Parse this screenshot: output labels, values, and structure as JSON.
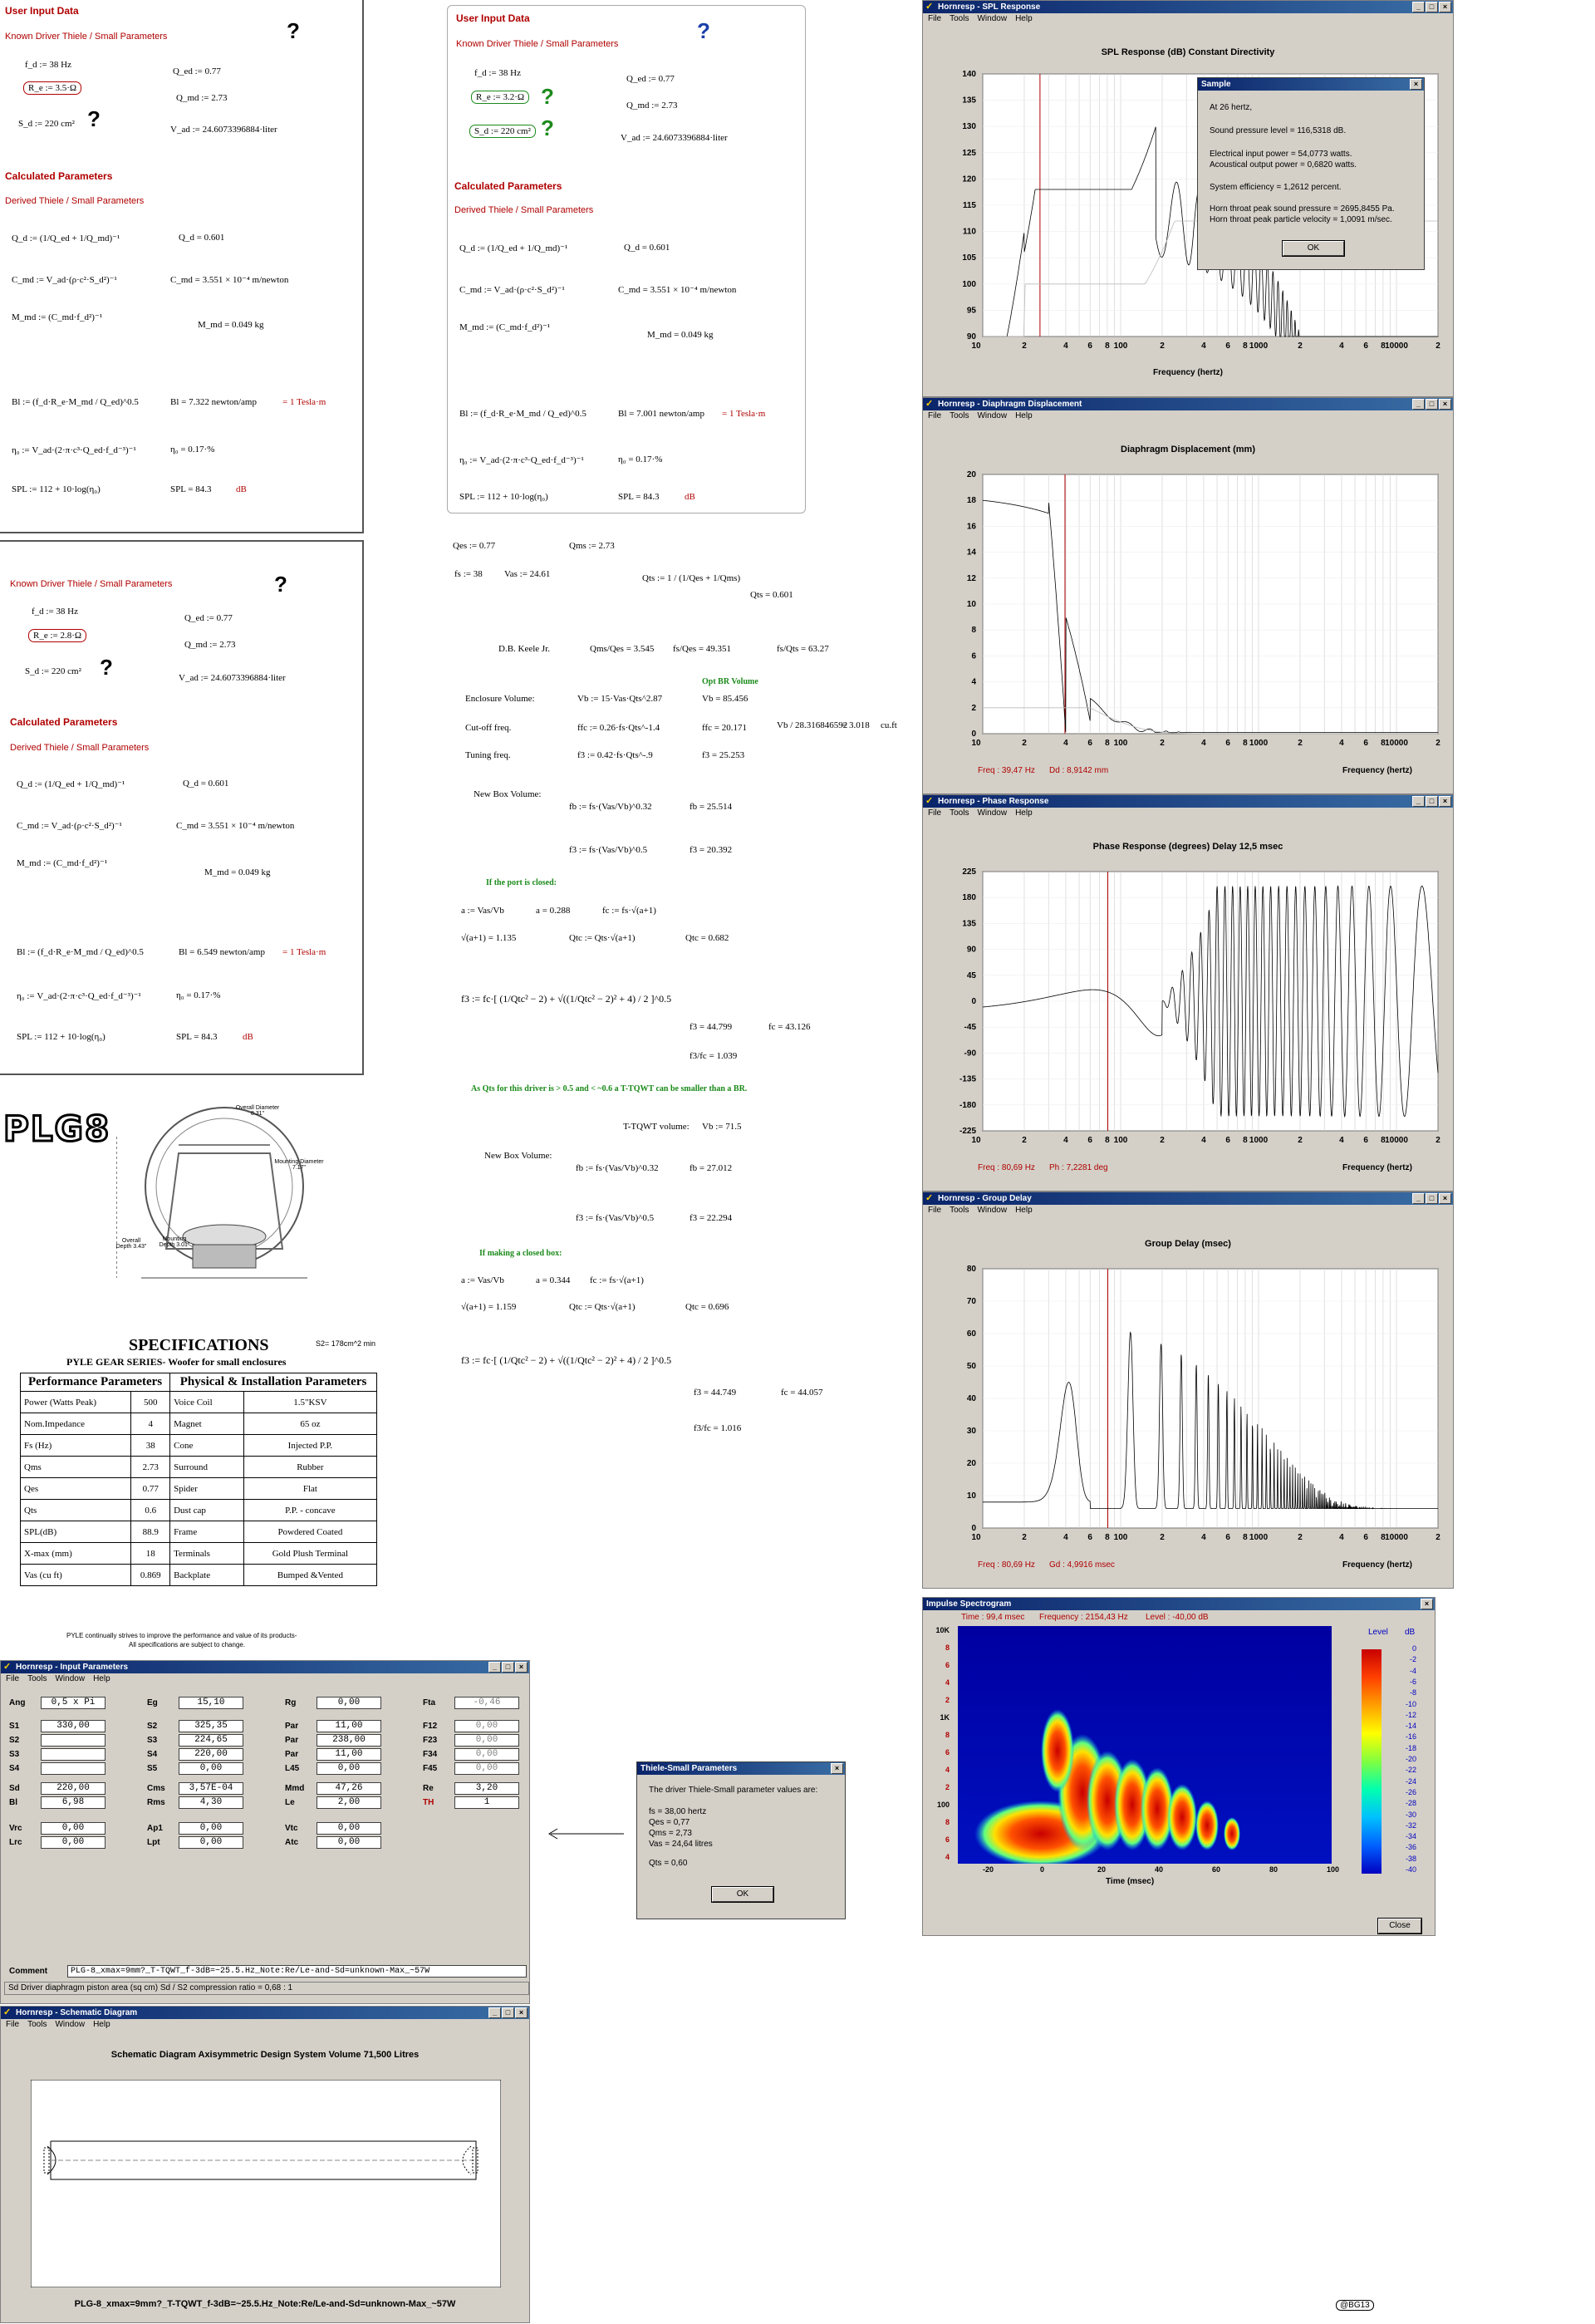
{
  "sheet1": {
    "user_input": "User Input Data",
    "known": "Known Driver Thiele / Small Parameters",
    "fd": "f_d := 38 Hz",
    "re": "R_e := 3.5·Ω",
    "sd": "S_d := 220 cm²",
    "qed": "Q_ed := 0.77",
    "qmd": "Q_md := 2.73",
    "vad": "V_ad := 24.6073396884·liter",
    "calc": "Calculated Parameters",
    "derived": "Derived Thiele / Small Parameters",
    "qd_def": "Q_d := (1/Q_ed + 1/Q_md)⁻¹",
    "qd_val": "Q_d = 0.601",
    "cmd_def": "C_md := V_ad·(ρ·c²·S_d²)⁻¹",
    "cmd_val": "C_md = 3.551 × 10⁻⁴ m/newton",
    "mmd_def": "M_md := (C_md·f_d²)⁻¹",
    "mmd_val": "M_md = 0.049 kg",
    "bl_def": "Bl := (f_d·R_e·M_md / Q_ed)^0.5",
    "bl_val": "Bl = 7.322 newton/amp",
    "bl_t": "= 1 Tesla·m",
    "eta_def": "η₀ := V_ad·(2·π·c³·Q_ed·f_d⁻³)⁻¹",
    "eta_val": "η₀ = 0.17·%",
    "spl_def": "SPL := 112 + 10·log(η₀)",
    "spl_val": "SPL = 84.3",
    "db": "dB",
    "q": "?"
  },
  "sheet2": {
    "user_input": "User Input Data",
    "known": "Known Driver Thiele / Small Parameters",
    "fd": "f_d := 38 Hz",
    "re": "R_e := 3.2·Ω",
    "sd": "S_d := 220 cm²",
    "qed": "Q_ed := 0.77",
    "qmd": "Q_md := 2.73",
    "vad": "V_ad := 24.6073396884·liter",
    "calc": "Calculated Parameters",
    "derived": "Derived Thiele / Small Parameters",
    "qd_def": "Q_d := (1/Q_ed + 1/Q_md)⁻¹",
    "qd_val": "Q_d = 0.601",
    "cmd_def": "C_md := V_ad·(ρ·c²·S_d²)⁻¹",
    "cmd_val": "C_md = 3.551 × 10⁻⁴ m/newton",
    "mmd_def": "M_md := (C_md·f_d²)⁻¹",
    "mmd_val": "M_md = 0.049 kg",
    "bl_def": "Bl := (f_d·R_e·M_md / Q_ed)^0.5",
    "bl_val": "Bl = 7.001 newton/amp",
    "bl_t": "= 1 Tesla·m",
    "eta_def": "η₀ := V_ad·(2·π·c³·Q_ed·f_d⁻³)⁻¹",
    "eta_val": "η₀ = 0.17·%",
    "spl_def": "SPL := 112 + 10·log(η₀)",
    "spl_val": "SPL = 84.3",
    "db": "dB",
    "q": "?",
    "check": "?"
  },
  "sheet3": {
    "known": "Known Driver Thiele / Small Parameters",
    "fd": "f_d := 38 Hz",
    "re": "R_e := 2.8·Ω",
    "sd": "S_d := 220 cm²",
    "qed": "Q_ed := 0.77",
    "qmd": "Q_md := 2.73",
    "vad": "V_ad := 24.6073396884·liter",
    "calc": "Calculated Parameters",
    "derived": "Derived Thiele / Small Parameters",
    "qd_def": "Q_d := (1/Q_ed + 1/Q_md)⁻¹",
    "qd_val": "Q_d = 0.601",
    "cmd_def": "C_md := V_ad·(ρ·c²·S_d²)⁻¹",
    "cmd_val": "C_md = 3.551 × 10⁻⁴ m/newton",
    "mmd_def": "M_md := (C_md·f_d²)⁻¹",
    "mmd_val": "M_md = 0.049 kg",
    "bl_def": "Bl := (f_d·R_e·M_md / Q_ed)^0.5",
    "bl_val": "Bl = 6.549 newton/amp",
    "bl_t": "= 1 Tesla·m",
    "eta_def": "η₀ := V_ad·(2·π·c³·Q_ed·f_d⁻³)⁻¹",
    "eta_val": "η₀ = 0.17·%",
    "spl_def": "SPL := 112 + 10·log(η₀)",
    "spl_val": "SPL = 84.3",
    "db": "dB",
    "q": "?"
  },
  "calc": {
    "qes": "Qes := 0.77",
    "qms": "Qms := 2.73",
    "fs": "fs := 38",
    "vas": "Vas := 24.61",
    "qts_def": "Qts := 1 / (1/Qes + 1/Qms)",
    "qts_val": "Qts = 0.601",
    "keele": "D.B. Keele Jr.",
    "k1": "Qms/Qes = 3.545",
    "k2": "fs/Qes = 49.351",
    "k3": "fs/Qts = 63.27",
    "optbr": "Opt BR Volume",
    "encl_lbl": "Enclosure Volume:",
    "encl_def": "Vb := 15·Vas·Qts^2.87",
    "encl_val": "Vb = 85.456",
    "cut_lbl": "Cut-off freq.",
    "cut_def": "ffc := 0.26·fs·Qts^-1.4",
    "cut_val": "ffc = 20.171",
    "cuft_def": "Vb / 28.316846592",
    "cuft_val": "= 3.018",
    "cuft_unit": "cu.ft",
    "tune_lbl": "Tuning freq.",
    "tune_def": "f3 := 0.42·fs·Qts^-.9",
    "tune_val": "f3 = 25.253",
    "nbv": "New Box Volume:",
    "fb1_def": "fb := fs·(Vas/Vb)^0.32",
    "fb1_val": "fb = 25.514",
    "f31_def": "f3 := fs·(Vas/Vb)^0.5",
    "f31_val": "f3 = 20.392",
    "closed1": "If the port is closed:",
    "a1_def": "a := Vas/Vb",
    "a1_val": "a = 0.288",
    "fc1_def": "fc := fs·√(a+1)",
    "sq1": "√(a+1) = 1.135",
    "qtc1_def": "Qtc := Qts·√(a+1)",
    "qtc1_val": "Qtc = 0.682",
    "f3big1": "f3 := fc·[ (1/Qtc² − 2) + √((1/Qtc² − 2)² + 4) / 2 ]^0.5",
    "f3big1_val": "f3 = 44.799",
    "fc1_val": "fc = 43.126",
    "ratio1": "f3/fc = 1.039",
    "note": "As Qts for this driver is > 0.5  and < ~0.6 a T-TQWT can be smaller than a BR.",
    "ttqwt": "T-TQWT volume:",
    "ttqwt_val": "Vb := 71.5",
    "nbv2": "New Box Volume:",
    "fb2_def": "fb := fs·(Vas/Vb)^0.32",
    "fb2_val": "fb = 27.012",
    "f32_def": "f3 := fs·(Vas/Vb)^0.5",
    "f32_val": "f3 = 22.294",
    "closed2": "If making a closed box:",
    "a2_def": "a := Vas/Vb",
    "a2_val": "a = 0.344",
    "fc2_def": "fc := fs·√(a+1)",
    "sq2": "√(a+1) = 1.159",
    "qtc2_def": "Qtc := Qts·√(a+1)",
    "qtc2_val": "Qtc = 0.696",
    "f3big2": "f3 := fc·[ (1/Qtc² − 2) + √((1/Qtc² − 2)² + 4) / 2 ]^0.5",
    "f3big2_val": "f3 = 44.749",
    "fc2_val": "fc = 44.057",
    "ratio2": "f3/fc = 1.016"
  },
  "spl_win": {
    "title": "Hornresp - SPL Response",
    "menu": [
      "File",
      "Tools",
      "Window",
      "Help"
    ],
    "chart_title": "SPL Response (dB)    Constant Directivity",
    "xlabel": "Frequency (hertz)",
    "sample": {
      "title": "Sample",
      "line1": "At 26 hertz,",
      "line2": "Sound pressure level = 116,5318 dB.",
      "line3": "Electrical input power = 54,0773 watts.",
      "line4": "Acoustical output power = 0,6820 watts.",
      "line5": "System efficiency = 1,2612 percent.",
      "line6": "Horn throat peak sound pressure = 2695,8455 Pa.",
      "line7": "Horn throat peak particle velocity = 1,0091 m/sec.",
      "ok": "OK"
    }
  },
  "dd_win": {
    "title": "Hornresp - Diaphragm Displacement",
    "menu": [
      "File",
      "Tools",
      "Window",
      "Help"
    ],
    "chart_title": "Diaphragm Displacement (mm)",
    "xlabel": "Frequency (hertz)",
    "stat1": "Freq : 39,47 Hz",
    "stat2": "Dd : 8,9142 mm"
  },
  "ph_win": {
    "title": "Hornresp - Phase Response",
    "menu": [
      "File",
      "Tools",
      "Window",
      "Help"
    ],
    "chart_title": "Phase Response (degrees)    Delay 12,5 msec",
    "xlabel": "Frequency (hertz)",
    "stat1": "Freq : 80,69 Hz",
    "stat2": "Ph : 7,2281 deg"
  },
  "gd_win": {
    "title": "Hornresp - Group Delay",
    "menu": [
      "File",
      "Tools",
      "Window",
      "Help"
    ],
    "chart_title": "Group Delay (msec)",
    "xlabel": "Frequency (hertz)",
    "stat1": "Freq : 80,69 Hz",
    "stat2": "Gd : 4,9916 msec"
  },
  "spec_win": {
    "title": "Impulse Spectrogram",
    "time": "Time : 99,4 msec",
    "freq": "Frequency : 2154,43 Hz",
    "level": "Level : -40,00 dB",
    "xlabel": "Time (msec)",
    "level_lbl": "Level",
    "db_lbl": "dB",
    "close": "Close",
    "ylabels": [
      "10K",
      "8",
      "6",
      "4",
      "2",
      "1K",
      "8",
      "6",
      "4",
      "2",
      "100",
      "8",
      "6",
      "4"
    ],
    "xticks": [
      "-20",
      "0",
      "20",
      "40",
      "60",
      "80",
      "100"
    ],
    "scale": [
      "0",
      "-2",
      "-4",
      "-6",
      "-8",
      "-10",
      "-12",
      "-14",
      "-16",
      "-18",
      "-20",
      "-22",
      "-24",
      "-26",
      "-28",
      "-30",
      "-32",
      "-34",
      "-36",
      "-38",
      "-40"
    ]
  },
  "plg": {
    "logo": "PLG8",
    "overall_dia": "Overall Diameter 8.31\"",
    "mount_dia": "Mounting Diameter 7.17\"",
    "overall_depth": "Overall Depth 3.43\"",
    "mount_depth": "Mounting Depth 3.01\"",
    "specs": "SPECIFICATIONS",
    "s2": "S2= 178cm^2 min",
    "series": "PYLE GEAR SERIES- Woofer for small enclosures",
    "perf": "Performance Parameters",
    "phys": "Physical & Installation Parameters",
    "rows": [
      [
        "Power (Watts Peak)",
        "500",
        "Voice Coil",
        "1.5\"KSV"
      ],
      [
        "Nom.Impedance",
        "4",
        "Magnet",
        "65 oz"
      ],
      [
        "Fs (Hz)",
        "38",
        "Cone",
        "Injected P.P."
      ],
      [
        "Qms",
        "2.73",
        "Surround",
        "Rubber"
      ],
      [
        "Qes",
        "0.77",
        "Spider",
        "Flat"
      ],
      [
        "Qts",
        "0.6",
        "Dust cap",
        "P.P. - concave"
      ],
      [
        "SPL(dB)",
        "88.9",
        "Frame",
        "Powdered Coated"
      ],
      [
        "X-max (mm)",
        "18",
        "Terminals",
        "Gold Plush Terminal"
      ],
      [
        "Vas (cu ft)",
        "0.869",
        "Backplate",
        "Bumped &Vented"
      ]
    ],
    "foot1": "PYLE continually strives to improve the performance and value of its products-",
    "foot2": "All specifications are subject to change."
  },
  "input_win": {
    "title": "Hornresp - Input Parameters",
    "menu": [
      "File",
      "Tools",
      "Window",
      "Help"
    ],
    "ang": "Ang",
    "ang_v": "0,5 x Pi",
    "eg": "Eg",
    "eg_v": "15,10",
    "rg": "Rg",
    "rg_v": "0,00",
    "fta": "Fta",
    "fta_v": "-0,46",
    "s1": "S1",
    "s1_v": "330,00",
    "s2l": "S2",
    "s2_v": "325,35",
    "s3l": "S3",
    "s3_v": "224,65",
    "s4l": "S4",
    "s4_v": "0,00",
    "c2s2": "S2",
    "c2s2_v": "325,35",
    "c2s3": "S3",
    "c2s3_v": "224,65",
    "c2s4": "S4",
    "c2s4_v": "220,00",
    "c2s5": "S5",
    "c2s5_v": "0,00",
    "par1": "Par",
    "par1_v": "11,00",
    "par2": "Par",
    "par2_v": "238,00",
    "par3": "Par",
    "par3_v": "11,00",
    "l45": "L45",
    "l45_v": "0,00",
    "f12": "F12",
    "f12_v": "0,00",
    "f23": "F23",
    "f23_v": "0,00",
    "f34": "F34",
    "f34_v": "0,00",
    "f45": "F45",
    "f45_v": "0,00",
    "sd": "Sd",
    "sd_v": "220,00",
    "bl": "Bl",
    "bl_v": "6,98",
    "cms": "Cms",
    "cms_v": "3,57E-04",
    "rms": "Rms",
    "rms_v": "4,30",
    "mmd": "Mmd",
    "mmd_v": "47,26",
    "le": "Le",
    "le_v": "2,00",
    "re": "Re",
    "re_v": "3,20",
    "th": "TH",
    "th_v": "1",
    "vrc": "Vrc",
    "vrc_v": "0,00",
    "lrc": "Lrc",
    "lrc_v": "0,00",
    "ap1": "Ap1",
    "ap1_v": "0,00",
    "lpt": "Lpt",
    "lpt_v": "0,00",
    "vtc": "Vtc",
    "vtc_v": "0,00",
    "atc": "Atc",
    "atc_v": "0,00",
    "comment": "Comment",
    "comment_v": "PLG-8_xmax=9mm?_T-TQWT_f-3dB=~25.5.Hz_Note:Re/Le-and-Sd=unknown-Max_~57W",
    "status": "Sd  Driver diaphragm piston area  (sq cm)     Sd / S2 compression ratio = 0,68 : 1"
  },
  "ts_dlg": {
    "title": "Thiele-Small Parameters",
    "line0": "The driver Thiele-Small parameter values are:",
    "fs": "fs = 38,00 hertz",
    "qes": "Qes = 0,77",
    "qms": "Qms = 2,73",
    "vas": "Vas = 24,64 litres",
    "qts": "Qts = 0,60",
    "ok": "OK"
  },
  "sch_win": {
    "title": "Hornresp - Schematic Diagram",
    "menu": [
      "File",
      "Tools",
      "Window",
      "Help"
    ],
    "heading": "Schematic Diagram    Axisymmetric Design    System Volume 71,500 Litres",
    "caption": "PLG-8_xmax=9mm?_T-TQWT_f-3dB=~25.5.Hz_Note:Re/Le-and-Sd=unknown-Max_~57W"
  },
  "badge": "@BG13",
  "charts": {
    "type": "line",
    "spl": {
      "ylim": [
        90,
        140
      ],
      "yticks": [
        140,
        135,
        130,
        125,
        120,
        115,
        110,
        105,
        100,
        95,
        90
      ],
      "xlim": [
        10,
        20000
      ],
      "xscale": "log",
      "marker_hz": 26
    },
    "dd": {
      "ylim": [
        0,
        20
      ],
      "yticks": [
        20,
        18,
        16,
        14,
        12,
        10,
        8,
        6,
        4,
        2,
        0
      ],
      "xlim": [
        10,
        20000
      ],
      "xscale": "log",
      "marker_hz": 39.47
    },
    "phase": {
      "ylim": [
        -225,
        225
      ],
      "yticks": [
        225,
        180,
        135,
        90,
        45,
        0,
        -45,
        -90,
        -135,
        -180,
        -225
      ],
      "xlim": [
        10,
        20000
      ],
      "xscale": "log",
      "marker_hz": 80.69
    },
    "gd": {
      "ylim": [
        0,
        80
      ],
      "yticks": [
        80,
        70,
        60,
        50,
        40,
        30,
        20,
        10,
        0
      ],
      "xlim": [
        10,
        20000
      ],
      "xscale": "log",
      "marker_hz": 80.69
    },
    "xticks": [
      "10",
      "2",
      "4",
      "6",
      "8",
      "100",
      "2",
      "4",
      "6",
      "8",
      "1000",
      "2",
      "4",
      "6",
      "8",
      "10000",
      "2"
    ]
  }
}
